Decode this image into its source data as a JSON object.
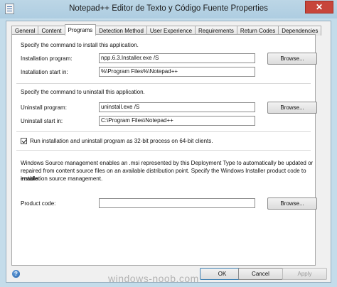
{
  "window": {
    "title": "Notepad++ Editor de Texto y Código Fuente Properties",
    "close_glyph": "✕",
    "icon": "notepad-document-icon"
  },
  "tabs": [
    {
      "label": "General"
    },
    {
      "label": "Content"
    },
    {
      "label": "Programs",
      "active": true
    },
    {
      "label": "Detection Method"
    },
    {
      "label": "User Experience"
    },
    {
      "label": "Requirements"
    },
    {
      "label": "Return Codes"
    },
    {
      "label": "Dependencies"
    }
  ],
  "install": {
    "heading": "Specify the command to install this application.",
    "program_label": "Installation program:",
    "program_value": "npp.6.3.Installer.exe /S",
    "startin_label": "Installation start in:",
    "startin_value": "%\\Program Files%\\Notepad++",
    "browse_label": "Browse..."
  },
  "uninstall": {
    "heading": "Specify the command to uninstall this application.",
    "program_label": "Uninstall program:",
    "program_value": "uninstall.exe /S",
    "startin_label": "Uninstall start in:",
    "startin_value": "C:\\Program Files\\Notepad++",
    "browse_label": "Browse..."
  },
  "run32": {
    "label": "Run installation and uninstall program as 32-bit process on 64-bit clients.",
    "checked": true
  },
  "source_mgmt": {
    "text_line1": "Windows Source management enables an .msi represented by this Deployment Type to automatically be updated or",
    "text_line2": "repaired from content source files on an available distribution point. Specify the Windows Installer product code to enable",
    "text_line3": "installation source management.",
    "product_label": "Product code:",
    "product_value": "",
    "browse_label": "Browse..."
  },
  "footer": {
    "ok_label": "OK",
    "cancel_label": "Cancel",
    "apply_label": "Apply",
    "help_glyph": "?"
  },
  "watermark": "windows-noob.com"
}
